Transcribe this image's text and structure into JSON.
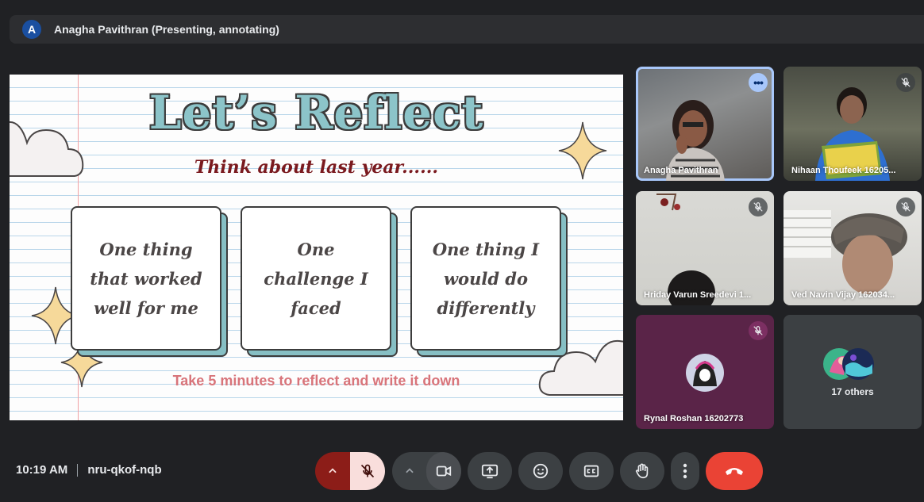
{
  "presenter": {
    "avatar_letter": "A",
    "label": "Anagha Pavithran (Presenting, annotating)"
  },
  "slide": {
    "title": "Let’s Reflect",
    "subtitle": "Think about last year......",
    "cards": [
      "One thing that worked well for me",
      "One challenge I faced",
      "One thing I would do differently"
    ],
    "footer": "Take 5 minutes to reflect and write it down",
    "colors": {
      "title": "#8cc4c9",
      "subtitle": "#7a1a1f",
      "footer": "#d8747a",
      "card_shadow": "#86bfc4"
    }
  },
  "participants": [
    {
      "name": "Anagha Pavithran",
      "muted": false,
      "active": true
    },
    {
      "name": "Nihaan Thoufeek 16205...",
      "muted": true
    },
    {
      "name": "Hriday Varun Sreedevi 1...",
      "muted": true
    },
    {
      "name": "Ved Navin Vijay 162034...",
      "muted": true
    },
    {
      "name": "Rynal Roshan 16202773",
      "muted": true
    },
    {
      "name": "17 others"
    }
  ],
  "meeting": {
    "time": "10:19 AM",
    "code": "nru-qkof-nqb"
  },
  "controls": {
    "mic_state": "muted",
    "end_call_color": "#ea4335",
    "icons": [
      "chevron-up-icon",
      "mic-off-icon",
      "chevron-up-icon",
      "camera-icon",
      "present-screen-icon",
      "emoji-icon",
      "captions-icon",
      "raise-hand-icon",
      "more-vert-icon",
      "end-call-icon"
    ]
  }
}
